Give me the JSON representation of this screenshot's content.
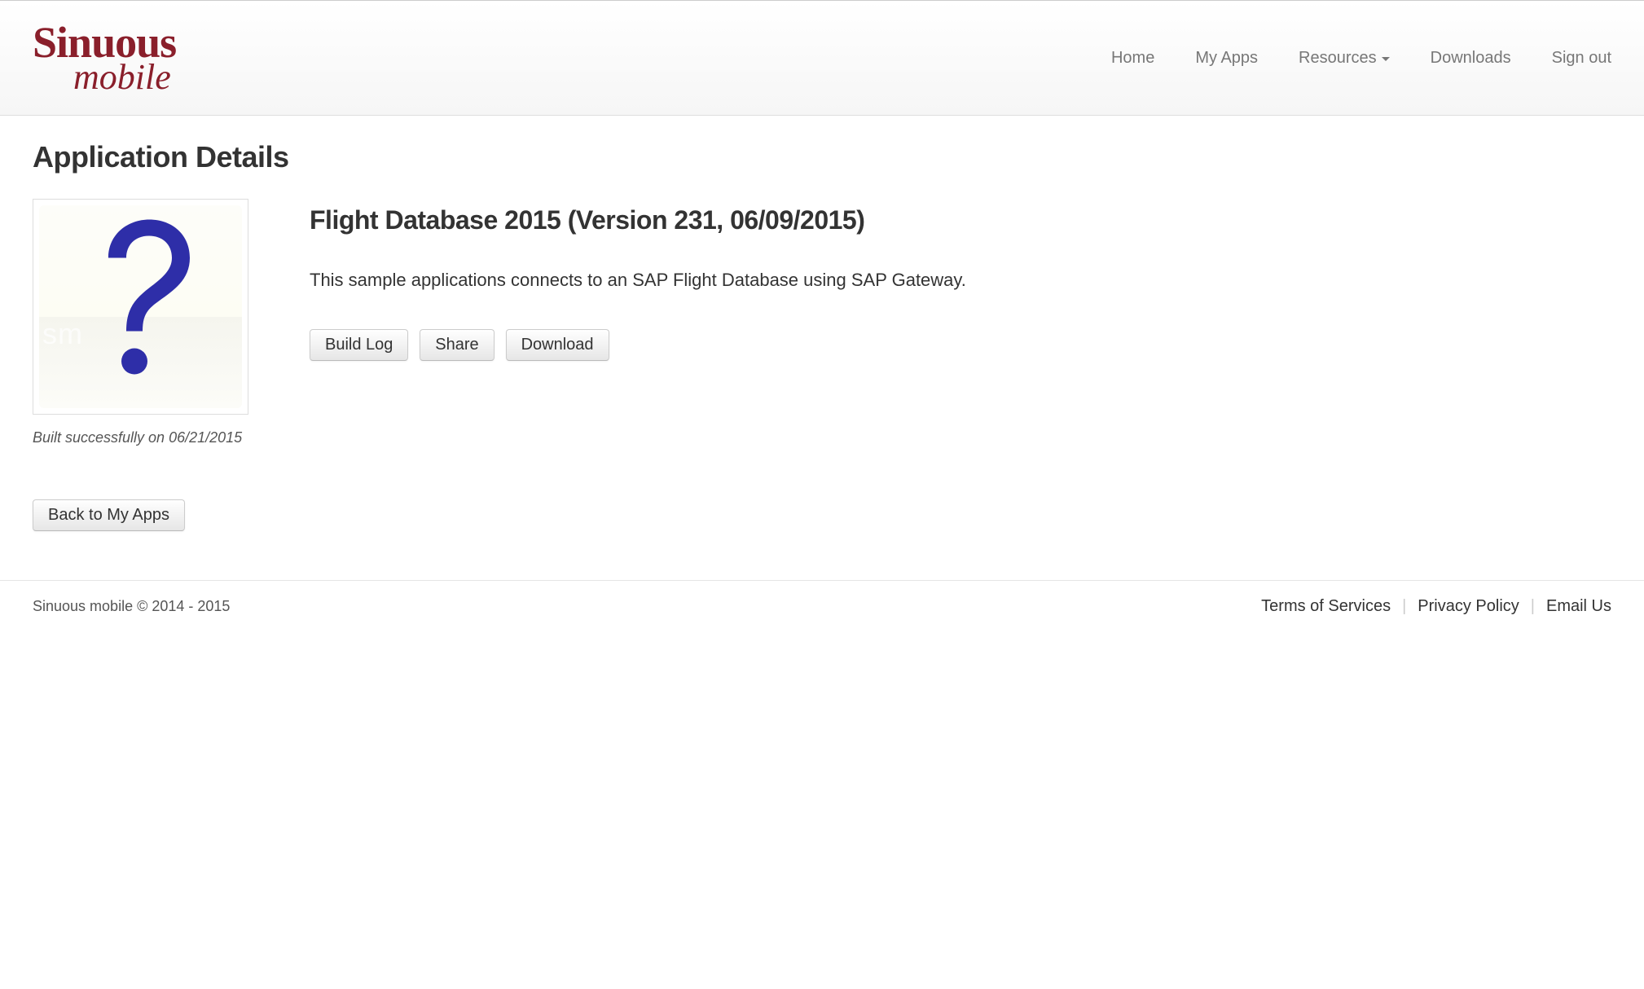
{
  "brand": {
    "top": "Sinuous",
    "bottom": "mobile"
  },
  "nav": {
    "home": "Home",
    "myApps": "My Apps",
    "resources": "Resources",
    "downloads": "Downloads",
    "signOut": "Sign out"
  },
  "page": {
    "title": "Application Details"
  },
  "app": {
    "title": "Flight Database 2015 (Version 231, 06/09/2015)",
    "description": "This sample applications connects to an SAP Flight Database using SAP Gateway.",
    "iconWatermark": "sm",
    "buildStatus": "Built successfully on 06/21/2015"
  },
  "buttons": {
    "buildLog": "Build Log",
    "share": "Share",
    "download": "Download",
    "back": "Back to My Apps"
  },
  "footer": {
    "copyright": "Sinuous mobile © 2014 - 2015",
    "terms": "Terms of Services",
    "privacy": "Privacy Policy",
    "email": "Email Us"
  }
}
